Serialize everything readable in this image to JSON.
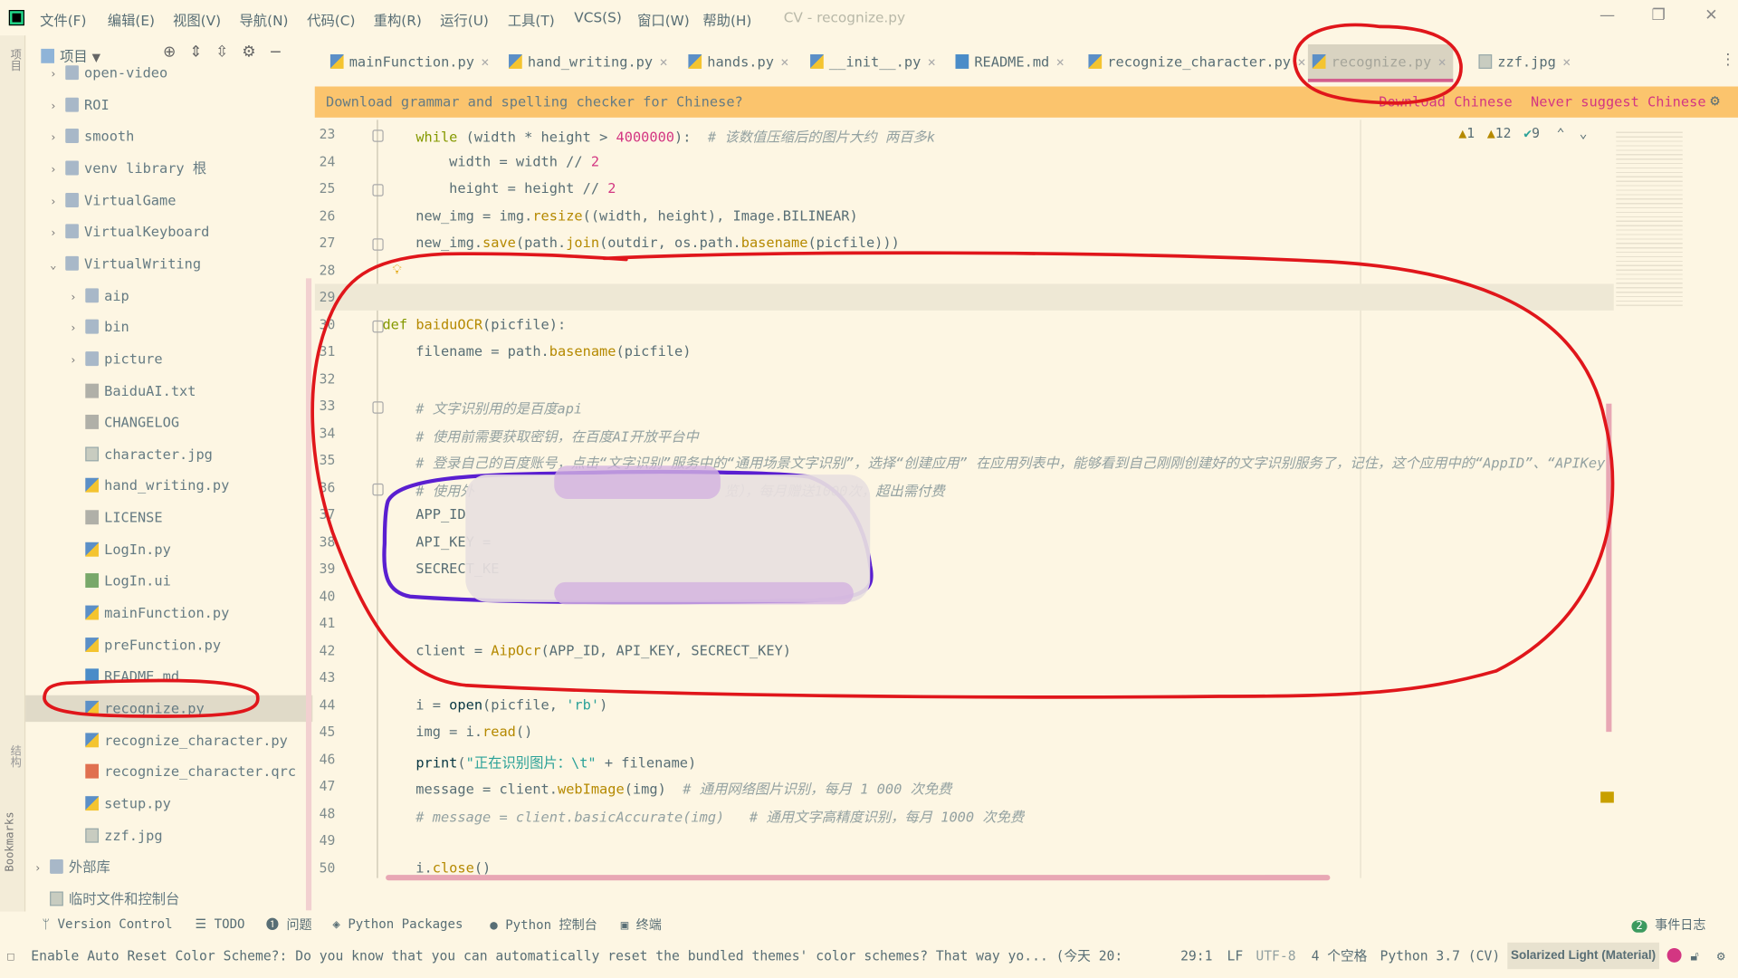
{
  "menu": {
    "items": [
      "文件(F)",
      "编辑(E)",
      "视图(V)",
      "导航(N)",
      "代码(C)",
      "重构(R)",
      "运行(U)",
      "工具(T)",
      "VCS(S)",
      "窗口(W)",
      "帮助(H)"
    ],
    "window_title": "CV - recognize.py"
  },
  "project": {
    "title": "项目",
    "tree": [
      {
        "label": "open-video",
        "type": "folder",
        "depth": 0,
        "expanded": false
      },
      {
        "label": "ROI",
        "type": "folder",
        "depth": 0,
        "expanded": false
      },
      {
        "label": "smooth",
        "type": "folder",
        "depth": 0,
        "expanded": false
      },
      {
        "label": "venv  library 根",
        "type": "folder",
        "depth": 0,
        "expanded": false
      },
      {
        "label": "VirtualGame",
        "type": "folder",
        "depth": 0,
        "expanded": false
      },
      {
        "label": "VirtualKeyboard",
        "type": "folder",
        "depth": 0,
        "expanded": false
      },
      {
        "label": "VirtualWriting",
        "type": "folder",
        "depth": 0,
        "expanded": true
      },
      {
        "label": "aip",
        "type": "folder",
        "depth": 1,
        "expanded": false
      },
      {
        "label": "bin",
        "type": "folder",
        "depth": 1,
        "expanded": false
      },
      {
        "label": "picture",
        "type": "folder",
        "depth": 1,
        "expanded": false
      },
      {
        "label": "BaiduAI.txt",
        "type": "txt",
        "depth": 1
      },
      {
        "label": "CHANGELOG",
        "type": "txt",
        "depth": 1
      },
      {
        "label": "character.jpg",
        "type": "img",
        "depth": 1
      },
      {
        "label": "hand_writing.py",
        "type": "py",
        "depth": 1
      },
      {
        "label": "LICENSE",
        "type": "txt",
        "depth": 1
      },
      {
        "label": "LogIn.py",
        "type": "py",
        "depth": 1
      },
      {
        "label": "LogIn.ui",
        "type": "ui",
        "depth": 1
      },
      {
        "label": "mainFunction.py",
        "type": "py",
        "depth": 1
      },
      {
        "label": "preFunction.py",
        "type": "py",
        "depth": 1
      },
      {
        "label": "README.md",
        "type": "md",
        "depth": 1
      },
      {
        "label": "recognize.py",
        "type": "py",
        "depth": 1,
        "selected": true
      },
      {
        "label": "recognize_character.py",
        "type": "py",
        "depth": 1
      },
      {
        "label": "recognize_character.qrc",
        "type": "qrc",
        "depth": 1
      },
      {
        "label": "setup.py",
        "type": "py",
        "depth": 1
      },
      {
        "label": "zzf.jpg",
        "type": "img",
        "depth": 1
      },
      {
        "label": "外部库",
        "type": "lib",
        "depth": -1,
        "expanded": false
      },
      {
        "label": "临时文件和控制台",
        "type": "scratch",
        "depth": -1
      }
    ]
  },
  "tabs": [
    {
      "label": "mainFunction.py",
      "type": "py"
    },
    {
      "label": "hand_writing.py",
      "type": "py"
    },
    {
      "label": "hands.py",
      "type": "py"
    },
    {
      "label": "__init__.py",
      "type": "py"
    },
    {
      "label": "README.md",
      "type": "md"
    },
    {
      "label": "recognize_character.py",
      "type": "py"
    },
    {
      "label": "recognize.py",
      "type": "py",
      "active": true
    },
    {
      "label": "zzf.jpg",
      "type": "img"
    }
  ],
  "banner": {
    "message": "Download grammar and spelling checker for Chinese?",
    "download": "Download Chinese",
    "never": "Never suggest Chinese"
  },
  "inspections": {
    "warnings": "1",
    "weak_warnings": "12",
    "typos": "9"
  },
  "editor": {
    "current_line": 29,
    "lines": [
      {
        "n": 23,
        "t": [
          [
            "    ",
            "p"
          ],
          [
            "while",
            "k"
          ],
          [
            " (width * height > ",
            "p"
          ],
          [
            "4000000",
            "n"
          ],
          [
            "):  ",
            "p"
          ],
          [
            "# 该数值压缩后的图片大约 两百多k",
            "c"
          ]
        ]
      },
      {
        "n": 24,
        "t": [
          [
            "        width = width // ",
            "p"
          ],
          [
            "2",
            "n"
          ]
        ]
      },
      {
        "n": 25,
        "t": [
          [
            "        height = height // ",
            "p"
          ],
          [
            "2",
            "n"
          ]
        ]
      },
      {
        "n": 26,
        "t": [
          [
            "    new_img = img.",
            "p"
          ],
          [
            "resize",
            "f"
          ],
          [
            "((width, height), Image.BILINEAR)",
            "p"
          ]
        ]
      },
      {
        "n": 27,
        "t": [
          [
            "    new_img.",
            "p"
          ],
          [
            "save",
            "f"
          ],
          [
            "(path.",
            "p"
          ],
          [
            "join",
            "f"
          ],
          [
            "(outdir, os.path.",
            "p"
          ],
          [
            "basename",
            "f"
          ],
          [
            "(picfile)))",
            "p"
          ]
        ]
      },
      {
        "n": 28,
        "t": []
      },
      {
        "n": 29,
        "t": []
      },
      {
        "n": 30,
        "t": [
          [
            "def ",
            "k"
          ],
          [
            "baiduOCR",
            "f"
          ],
          [
            "(picfile):",
            "p"
          ]
        ]
      },
      {
        "n": 31,
        "t": [
          [
            "    filename = path.",
            "p"
          ],
          [
            "basename",
            "f"
          ],
          [
            "(picfile)",
            "p"
          ]
        ]
      },
      {
        "n": 32,
        "t": []
      },
      {
        "n": 33,
        "t": [
          [
            "    # 文字识别用的是百度api",
            "c"
          ]
        ]
      },
      {
        "n": 34,
        "t": [
          [
            "    # 使用前需要获取密钥，在百度AI开放平台中",
            "c"
          ]
        ]
      },
      {
        "n": 35,
        "t": [
          [
            "    # 登录自己的百度账号，点击“文字识别”服务中的“通用场景文字识别”，选择“创建应用” 在应用列表中，能够看到自己刚刚创建好的文字识别服务了，记住，这个应用中的“AppID”、“APIKey”、“S",
            "c"
          ]
        ]
      },
      {
        "n": 36,
        "t": [
          [
            "    # 使用外",
            "c"
          ],
          [
            "                              ",
            "p"
          ],
          [
            "览），每月赠送1000次，超出需付费",
            "c"
          ]
        ]
      },
      {
        "n": 37,
        "t": [
          [
            "    APP_ID",
            "p"
          ]
        ]
      },
      {
        "n": 38,
        "t": [
          [
            "    API_KEY =",
            "p"
          ]
        ]
      },
      {
        "n": 39,
        "t": [
          [
            "    SECRECT_KE",
            "p"
          ]
        ]
      },
      {
        "n": 40,
        "t": []
      },
      {
        "n": 41,
        "t": []
      },
      {
        "n": 42,
        "t": [
          [
            "    client = ",
            "p"
          ],
          [
            "AipOcr",
            "f"
          ],
          [
            "(APP_ID, API_KEY, SECRECT_KEY)",
            "p"
          ]
        ]
      },
      {
        "n": 43,
        "t": []
      },
      {
        "n": 44,
        "t": [
          [
            "    i = ",
            "p"
          ],
          [
            "open",
            "b"
          ],
          [
            "(picfile, ",
            "p"
          ],
          [
            "'rb'",
            "s"
          ],
          [
            ")",
            "p"
          ]
        ]
      },
      {
        "n": 45,
        "t": [
          [
            "    img = i.",
            "p"
          ],
          [
            "read",
            "f"
          ],
          [
            "()",
            "p"
          ]
        ]
      },
      {
        "n": 46,
        "t": [
          [
            "    ",
            "p"
          ],
          [
            "print",
            "b"
          ],
          [
            "(",
            "p"
          ],
          [
            "\"正在识别图片：\\t\"",
            "s"
          ],
          [
            " + filename)",
            "p"
          ]
        ]
      },
      {
        "n": 47,
        "t": [
          [
            "    message = client.",
            "p"
          ],
          [
            "webImage",
            "f"
          ],
          [
            "(img)  ",
            "p"
          ],
          [
            "# 通用网络图片识别，每月 1 000 次免费",
            "c"
          ]
        ]
      },
      {
        "n": 48,
        "t": [
          [
            "    # message = client.basicAccurate(img)   # 通用文字高精度识别，每月 1000 次免费",
            "c"
          ]
        ]
      },
      {
        "n": 49,
        "t": []
      },
      {
        "n": 50,
        "t": [
          [
            "    i.",
            "p"
          ],
          [
            "close",
            "f"
          ],
          [
            "()",
            "p"
          ]
        ]
      }
    ]
  },
  "toolwindows": [
    "Version Control",
    "TODO",
    "问题",
    "Python Packages",
    "Python 控制台",
    "终端"
  ],
  "event_log": {
    "count": "2",
    "label": "事件日志"
  },
  "status": {
    "message": "Enable Auto Reset Color Scheme?: Do you know that you can automatically reset the bundled themes' color schemes? That way yo... (今天 20:",
    "position": "29:1",
    "line_sep": "LF",
    "encoding": "UTF-8",
    "indent": "4 个空格",
    "interpreter": "Python 3.7 (CV)",
    "theme": "Solarized Light (Material)"
  },
  "side_labels": {
    "structure": "结构",
    "bookmarks": "Bookmarks",
    "project": "项目"
  },
  "colors": {
    "background": "#fdf6e3",
    "banner": "#fbc46d",
    "keyword": "#859900",
    "function": "#b58900",
    "number": "#d33682",
    "string": "#2aa198",
    "comment": "#93a1a1",
    "annotation_red": "#e0161b",
    "annotation_purple": "#5a1fd0"
  }
}
